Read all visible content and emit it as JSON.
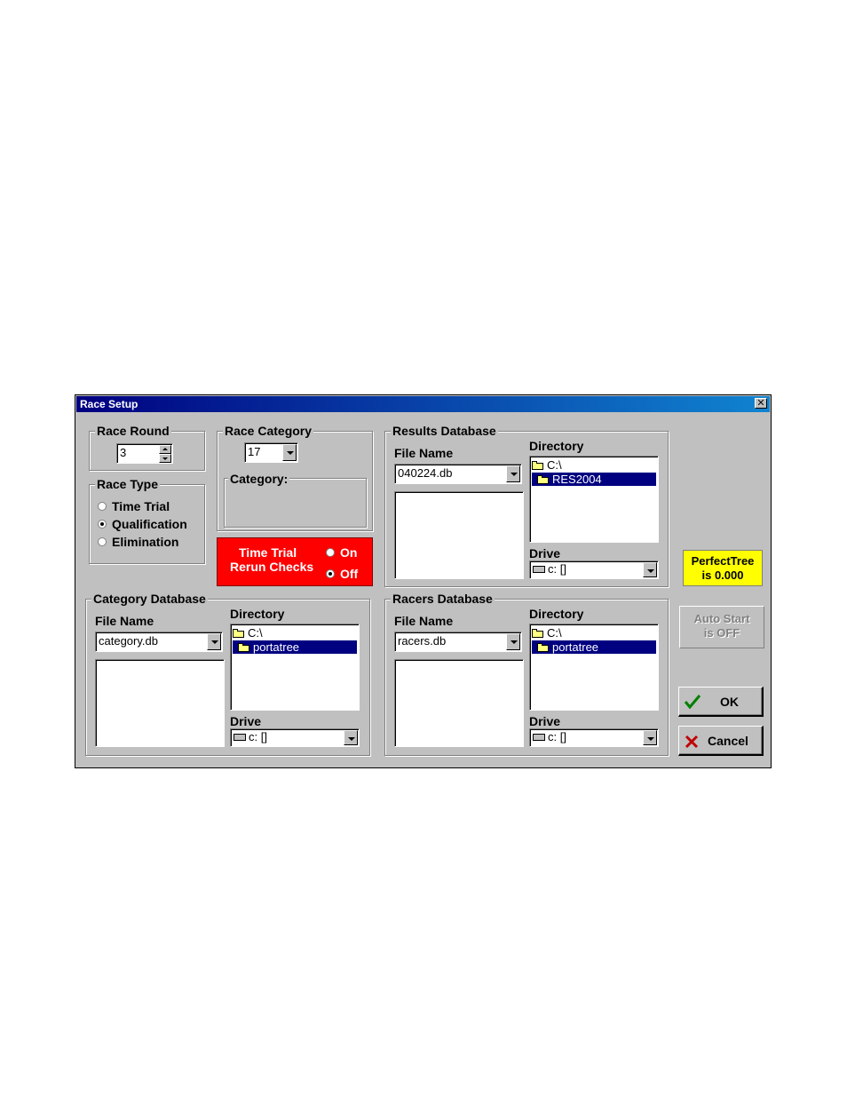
{
  "window": {
    "title": "Race Setup",
    "close_glyph": "✕"
  },
  "race_round": {
    "legend": "Race Round",
    "value": "3"
  },
  "race_category": {
    "legend": "Race Category",
    "value": "17",
    "category_legend": "Category:"
  },
  "race_type": {
    "legend": "Race Type",
    "options": [
      "Time Trial",
      "Qualification",
      "Elimination"
    ],
    "selected": "Qualification"
  },
  "rerun": {
    "label_line1": "Time Trial",
    "label_line2": "Rerun Checks",
    "on_label": "On",
    "off_label": "Off",
    "selected": "Off",
    "bg_color": "#ff0000"
  },
  "results_db": {
    "legend": "Results Database",
    "file_name_label": "File Name",
    "file_name": "040224.db",
    "directory_label": "Directory",
    "dir_root": "C:\\",
    "dir_selected": "RES2004",
    "drive_label": "Drive",
    "drive": "c: []"
  },
  "category_db": {
    "legend": "Category Database",
    "file_name_label": "File Name",
    "file_name": "category.db",
    "directory_label": "Directory",
    "dir_root": "C:\\",
    "dir_selected": "portatree",
    "drive_label": "Drive",
    "drive": "c: []"
  },
  "racers_db": {
    "legend": "Racers Database",
    "file_name_label": "File Name",
    "file_name": "racers.db",
    "directory_label": "Directory",
    "dir_root": "C:\\",
    "dir_selected": "portatree",
    "drive_label": "Drive",
    "drive": "c: []"
  },
  "perfect_tree": {
    "line1": "PerfectTree",
    "line2": "is 0.000",
    "bg_color": "#ffff00"
  },
  "auto_start": {
    "line1": "Auto Start",
    "line2": "is OFF"
  },
  "ok_button": {
    "label": "OK",
    "icon": "check-icon",
    "icon_color": "#008000"
  },
  "cancel_button": {
    "label": "Cancel",
    "icon": "x-icon",
    "icon_color": "#c00000"
  }
}
